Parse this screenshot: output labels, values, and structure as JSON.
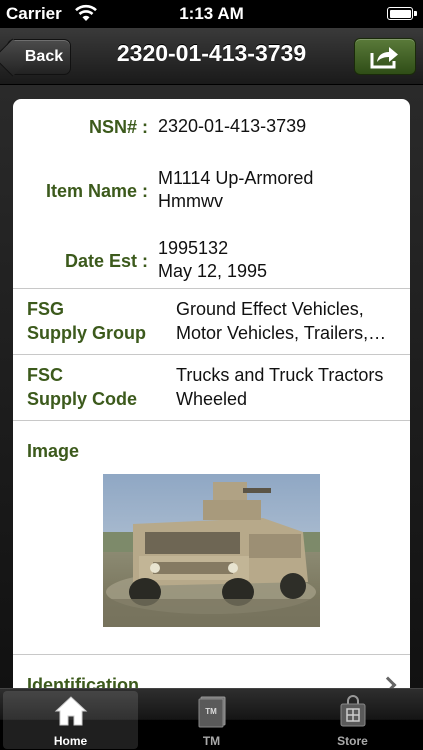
{
  "status_bar": {
    "carrier": "Carrier",
    "time": "1:13 AM"
  },
  "nav": {
    "back_label": "Back",
    "title": "2320-01-413-3739",
    "share_icon": "share-icon"
  },
  "details": {
    "nsn_label": "NSN# :",
    "nsn_value": "2320-01-413-3739",
    "item_name_label": "Item Name :",
    "item_name_line1": "M1114 Up-Armored",
    "item_name_line2": "Hmmwv",
    "date_label": "Date Est :",
    "date_line1": "1995132",
    "date_line2": "May 12, 1995"
  },
  "fsg": {
    "label_line1": "FSG",
    "label_line2": "Supply Group",
    "value_line1": "Ground Effect Vehicles,",
    "value_line2": "Motor Vehicles, Trailers,…"
  },
  "fsc": {
    "label_line1": "FSC",
    "label_line2": "Supply Code",
    "value_line1": "Trucks and Truck Tractors",
    "value_line2": "Wheeled"
  },
  "image_section": {
    "label": "Image"
  },
  "identification": {
    "label": "Identification"
  },
  "tabs": [
    {
      "label": "Home",
      "icon": "home-icon",
      "active": true
    },
    {
      "label": "TM",
      "icon": "book-icon",
      "active": false
    },
    {
      "label": "Store",
      "icon": "shopping-bag-icon",
      "active": false
    }
  ],
  "colors": {
    "label_green": "#3c5a1c",
    "share_button": "#4a6a2c"
  }
}
